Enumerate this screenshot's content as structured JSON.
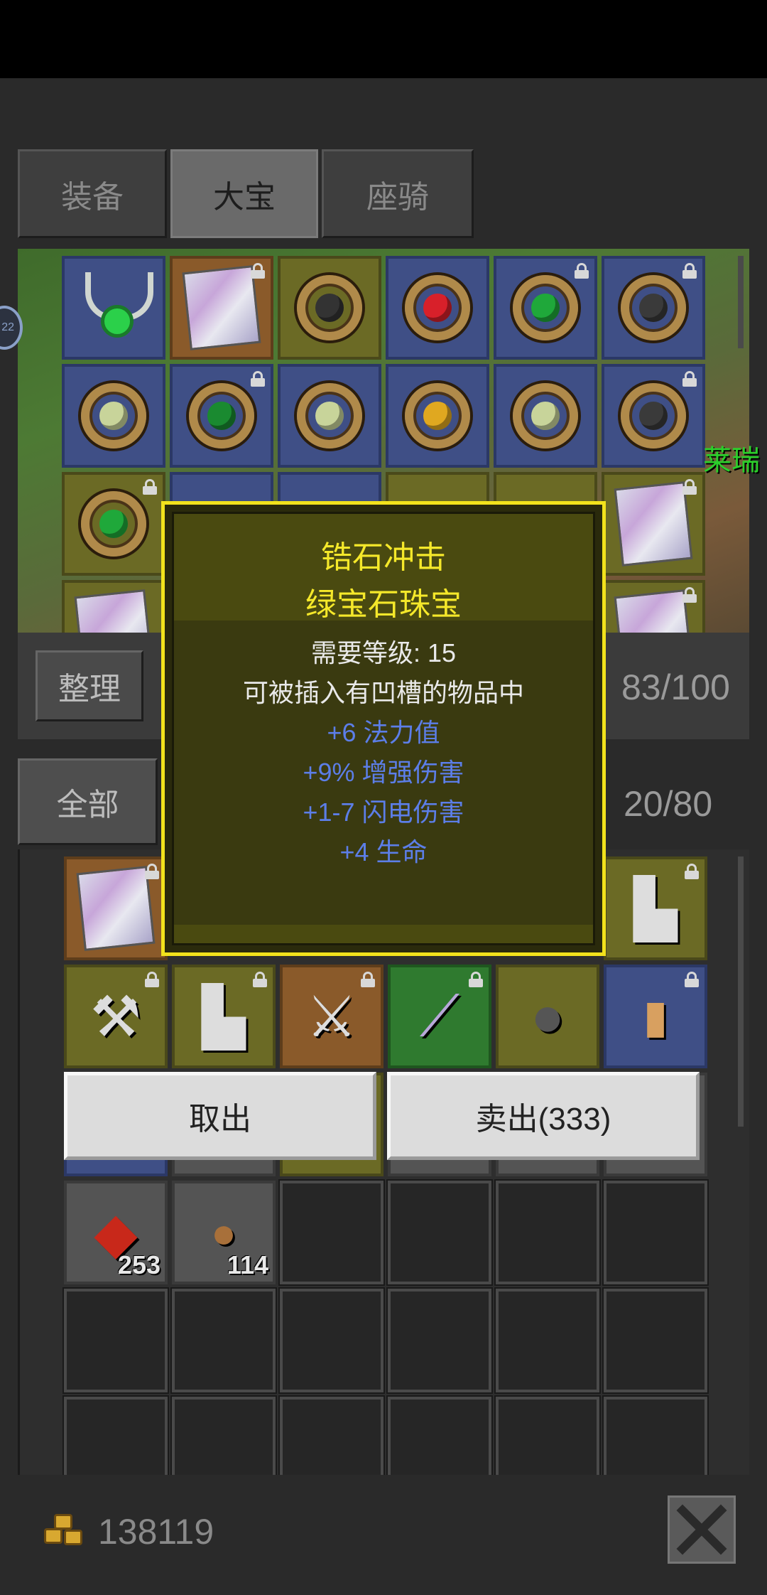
{
  "tabs": [
    {
      "label": "装备",
      "active": false
    },
    {
      "label": "大宝",
      "active": true
    },
    {
      "label": "座骑",
      "active": false
    }
  ],
  "stash": {
    "sort_label": "整理",
    "capacity": "83/100",
    "npc_name": "莱瑞",
    "side_badge": "22"
  },
  "inventory": {
    "filter_label": "全部",
    "capacity": "20/80",
    "stack_counts": [
      "253",
      "114"
    ]
  },
  "tooltip": {
    "name": "锆石冲击",
    "type": "绿宝石珠宝",
    "required_level": "需要等级: 15",
    "socket_note": "可被插入有凹槽的物品中",
    "stats": [
      "+6 法力值",
      "+9% 增强伤害",
      "+1-7 闪电伤害",
      "+4 生命"
    ]
  },
  "actions": {
    "take_out_label": "取出",
    "sell_label": "卖出(333)"
  },
  "footer": {
    "gold": "138119"
  },
  "colors": {
    "tooltip_border": "#f2e21c",
    "tooltip_title": "#f5e82a",
    "stat_blue": "#5c7ee8"
  },
  "icons": [
    "gem-icon",
    "amulet-icon",
    "charm-card-icon",
    "lock-icon",
    "axe-icon",
    "boots-icon",
    "sword-icon",
    "shield-icon",
    "scroll-icon",
    "meat-icon",
    "potato-icon",
    "gold-icon",
    "close-icon"
  ]
}
